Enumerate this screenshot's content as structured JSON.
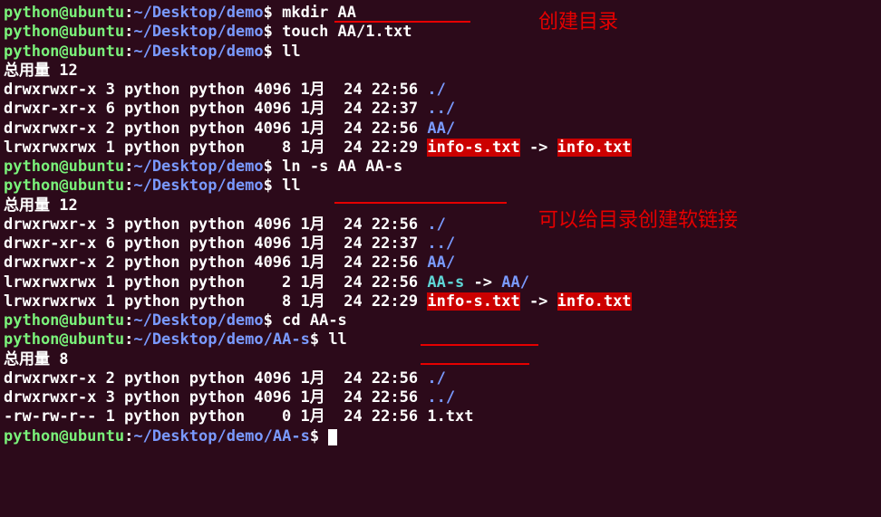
{
  "annotations": {
    "ann1": "创建目录",
    "ann2": "可以给目录创建软链接"
  },
  "prompt": {
    "user": "python",
    "at": "@",
    "host": "ubuntu",
    "colon": ":",
    "path1": "~/Desktop/demo",
    "path2": "~/Desktop/demo/AA-s",
    "dollar": "$"
  },
  "cmds": {
    "c1": "mkdir AA",
    "c2": "touch AA/1.txt",
    "c3": "ll",
    "c4": "ln -s AA AA-s",
    "c5": "ll",
    "c6": "cd AA-s",
    "c7": "ll"
  },
  "total": {
    "label": "总用量 ",
    "v1": "12",
    "v2": "12",
    "v3": "8"
  },
  "ls1": {
    "r1": {
      "perm": "drwxrwxr-x 3 python python 4096 1月  24 22:56 ",
      "name": "./"
    },
    "r2": {
      "perm": "drwxr-xr-x 6 python python 4096 1月  24 22:37 ",
      "name": "../"
    },
    "r3": {
      "perm": "drwxrwxr-x 2 python python 4096 1月  24 22:56 ",
      "name": "AA",
      "slash": "/"
    },
    "r4": {
      "perm": "lrwxrwxrwx 1 python python    8 1月  24 22:29 ",
      "linkname": "info-s.txt",
      "arrow": " -> ",
      "target": "info.txt"
    }
  },
  "ls2": {
    "r1": {
      "perm": "drwxrwxr-x 3 python python 4096 1月  24 22:56 ",
      "name": "./"
    },
    "r2": {
      "perm": "drwxr-xr-x 6 python python 4096 1月  24 22:37 ",
      "name": "../"
    },
    "r3": {
      "perm": "drwxrwxr-x 2 python python 4096 1月  24 22:56 ",
      "name": "AA",
      "slash": "/"
    },
    "r4": {
      "perm": "lrwxrwxrwx 1 python python    2 1月  24 22:56 ",
      "linkname": "AA-s",
      "arrow": " -> ",
      "target": "AA",
      "tslash": "/"
    },
    "r5": {
      "perm": "lrwxrwxrwx 1 python python    8 1月  24 22:29 ",
      "linkname": "info-s.txt",
      "arrow": " -> ",
      "target": "info.txt"
    }
  },
  "ls3": {
    "r1": {
      "perm": "drwxrwxr-x 2 python python 4096 1月  24 22:56 ",
      "name": "./"
    },
    "r2": {
      "perm": "drwxrwxr-x 3 python python 4096 1月  24 22:56 ",
      "name": "../"
    },
    "r3": {
      "perm": "-rw-rw-r-- 1 python python    0 1月  24 22:56 1.txt"
    }
  }
}
